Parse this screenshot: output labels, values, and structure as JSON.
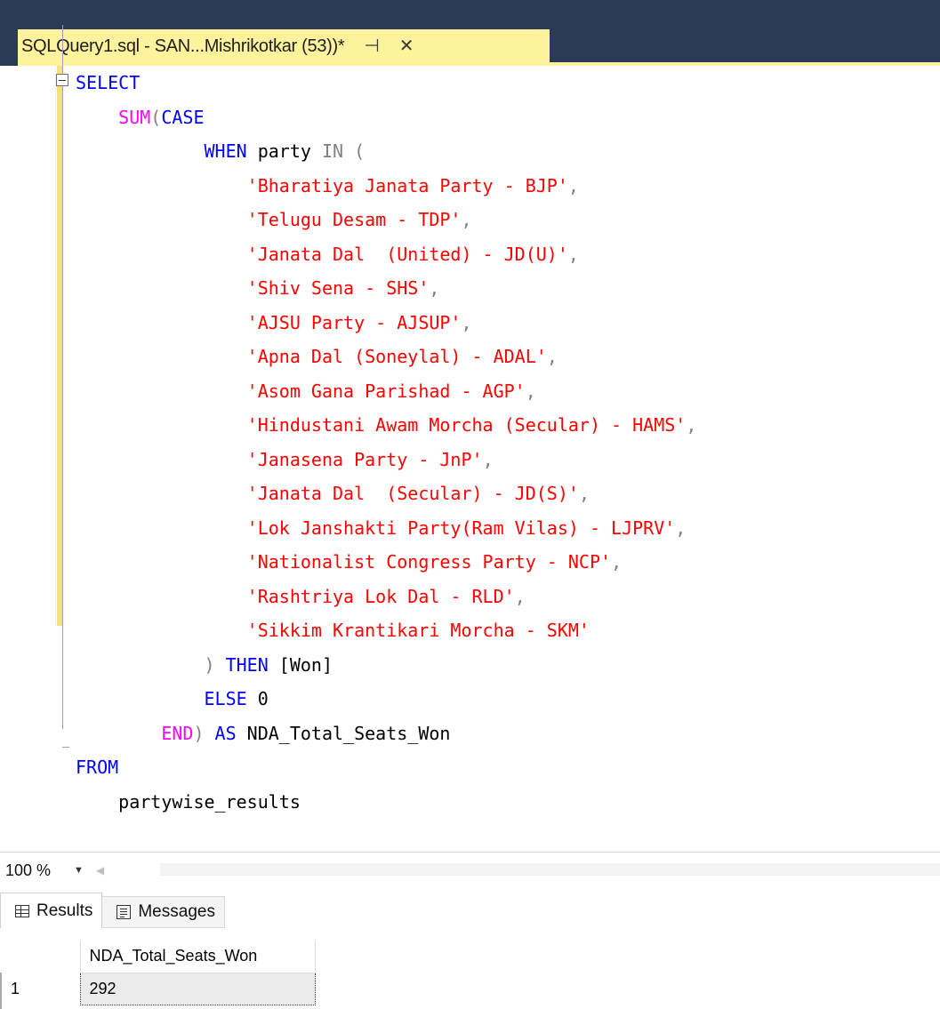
{
  "tab": {
    "title": "SQLQuery1.sql - SAN...Mishrikotkar (53))*",
    "pin_icon": "pin-icon",
    "close_icon": "close-icon"
  },
  "editor": {
    "lines": [
      [
        {
          "t": "SELECT",
          "c": "kw"
        }
      ],
      [
        {
          "t": "    "
        },
        {
          "t": "SUM",
          "c": "fn"
        },
        {
          "t": "(",
          "c": "op"
        },
        {
          "t": "CASE",
          "c": "kw"
        }
      ],
      [
        {
          "t": "            "
        },
        {
          "t": "WHEN",
          "c": "kw"
        },
        {
          "t": " party ",
          "c": "id"
        },
        {
          "t": "IN",
          "c": "op"
        },
        {
          "t": " (",
          "c": "op"
        }
      ],
      [
        {
          "t": "                "
        },
        {
          "t": "'Bharatiya Janata Party - BJP'",
          "c": "str"
        },
        {
          "t": ",",
          "c": "op"
        }
      ],
      [
        {
          "t": "                "
        },
        {
          "t": "'Telugu Desam - TDP'",
          "c": "str"
        },
        {
          "t": ",",
          "c": "op"
        }
      ],
      [
        {
          "t": "                "
        },
        {
          "t": "'Janata Dal  (United) - JD(U)'",
          "c": "str"
        },
        {
          "t": ",",
          "c": "op"
        }
      ],
      [
        {
          "t": "                "
        },
        {
          "t": "'Shiv Sena - SHS'",
          "c": "str"
        },
        {
          "t": ",",
          "c": "op"
        }
      ],
      [
        {
          "t": "                "
        },
        {
          "t": "'AJSU Party - AJSUP'",
          "c": "str"
        },
        {
          "t": ",",
          "c": "op"
        }
      ],
      [
        {
          "t": "                "
        },
        {
          "t": "'Apna Dal (Soneylal) - ADAL'",
          "c": "str"
        },
        {
          "t": ",",
          "c": "op"
        }
      ],
      [
        {
          "t": "                "
        },
        {
          "t": "'Asom Gana Parishad - AGP'",
          "c": "str"
        },
        {
          "t": ",",
          "c": "op"
        }
      ],
      [
        {
          "t": "                "
        },
        {
          "t": "'Hindustani Awam Morcha (Secular) - HAMS'",
          "c": "str"
        },
        {
          "t": ",",
          "c": "op"
        }
      ],
      [
        {
          "t": "                "
        },
        {
          "t": "'Janasena Party - JnP'",
          "c": "str"
        },
        {
          "t": ",",
          "c": "op"
        }
      ],
      [
        {
          "t": "                "
        },
        {
          "t": "'Janata Dal  (Secular) - JD(S)'",
          "c": "str"
        },
        {
          "t": ",",
          "c": "op"
        }
      ],
      [
        {
          "t": "                "
        },
        {
          "t": "'Lok Janshakti Party(Ram Vilas) - LJPRV'",
          "c": "str"
        },
        {
          "t": ",",
          "c": "op"
        }
      ],
      [
        {
          "t": "                "
        },
        {
          "t": "'Nationalist Congress Party - NCP'",
          "c": "str"
        },
        {
          "t": ",",
          "c": "op"
        }
      ],
      [
        {
          "t": "                "
        },
        {
          "t": "'Rashtriya Lok Dal - RLD'",
          "c": "str"
        },
        {
          "t": ",",
          "c": "op"
        }
      ],
      [
        {
          "t": "                "
        },
        {
          "t": "'Sikkim Krantikari Morcha - SKM'",
          "c": "str"
        }
      ],
      [
        {
          "t": "            "
        },
        {
          "t": ")",
          "c": "op"
        },
        {
          "t": " "
        },
        {
          "t": "THEN",
          "c": "kw"
        },
        {
          "t": " [Won]",
          "c": "id"
        }
      ],
      [
        {
          "t": "            "
        },
        {
          "t": "ELSE",
          "c": "kw"
        },
        {
          "t": " 0",
          "c": "id"
        }
      ],
      [
        {
          "t": "        "
        },
        {
          "t": "END",
          "c": "fn"
        },
        {
          "t": ")",
          "c": "op"
        },
        {
          "t": " "
        },
        {
          "t": "AS",
          "c": "kw"
        },
        {
          "t": " NDA_Total_Seats_Won",
          "c": "id"
        }
      ],
      [
        {
          "t": "FROM",
          "c": "kw"
        }
      ],
      [
        {
          "t": "    partywise_results",
          "c": "id"
        }
      ]
    ]
  },
  "zoom": {
    "value": "100 %",
    "dropdown_icon": "dropdown-arrow-icon"
  },
  "results": {
    "tabs": [
      {
        "label": "Results",
        "icon": "grid-icon"
      },
      {
        "label": "Messages",
        "icon": "messages-icon"
      }
    ],
    "columns": [
      "NDA_Total_Seats_Won"
    ],
    "rows": [
      {
        "num": "1",
        "cells": [
          "292"
        ]
      }
    ]
  },
  "colors": {
    "keyword": "#0000ff",
    "function": "#ff00ff",
    "string": "#ff0000",
    "operator": "#808080",
    "tab_active": "#fff29d",
    "titlebar": "#2b3a57"
  }
}
